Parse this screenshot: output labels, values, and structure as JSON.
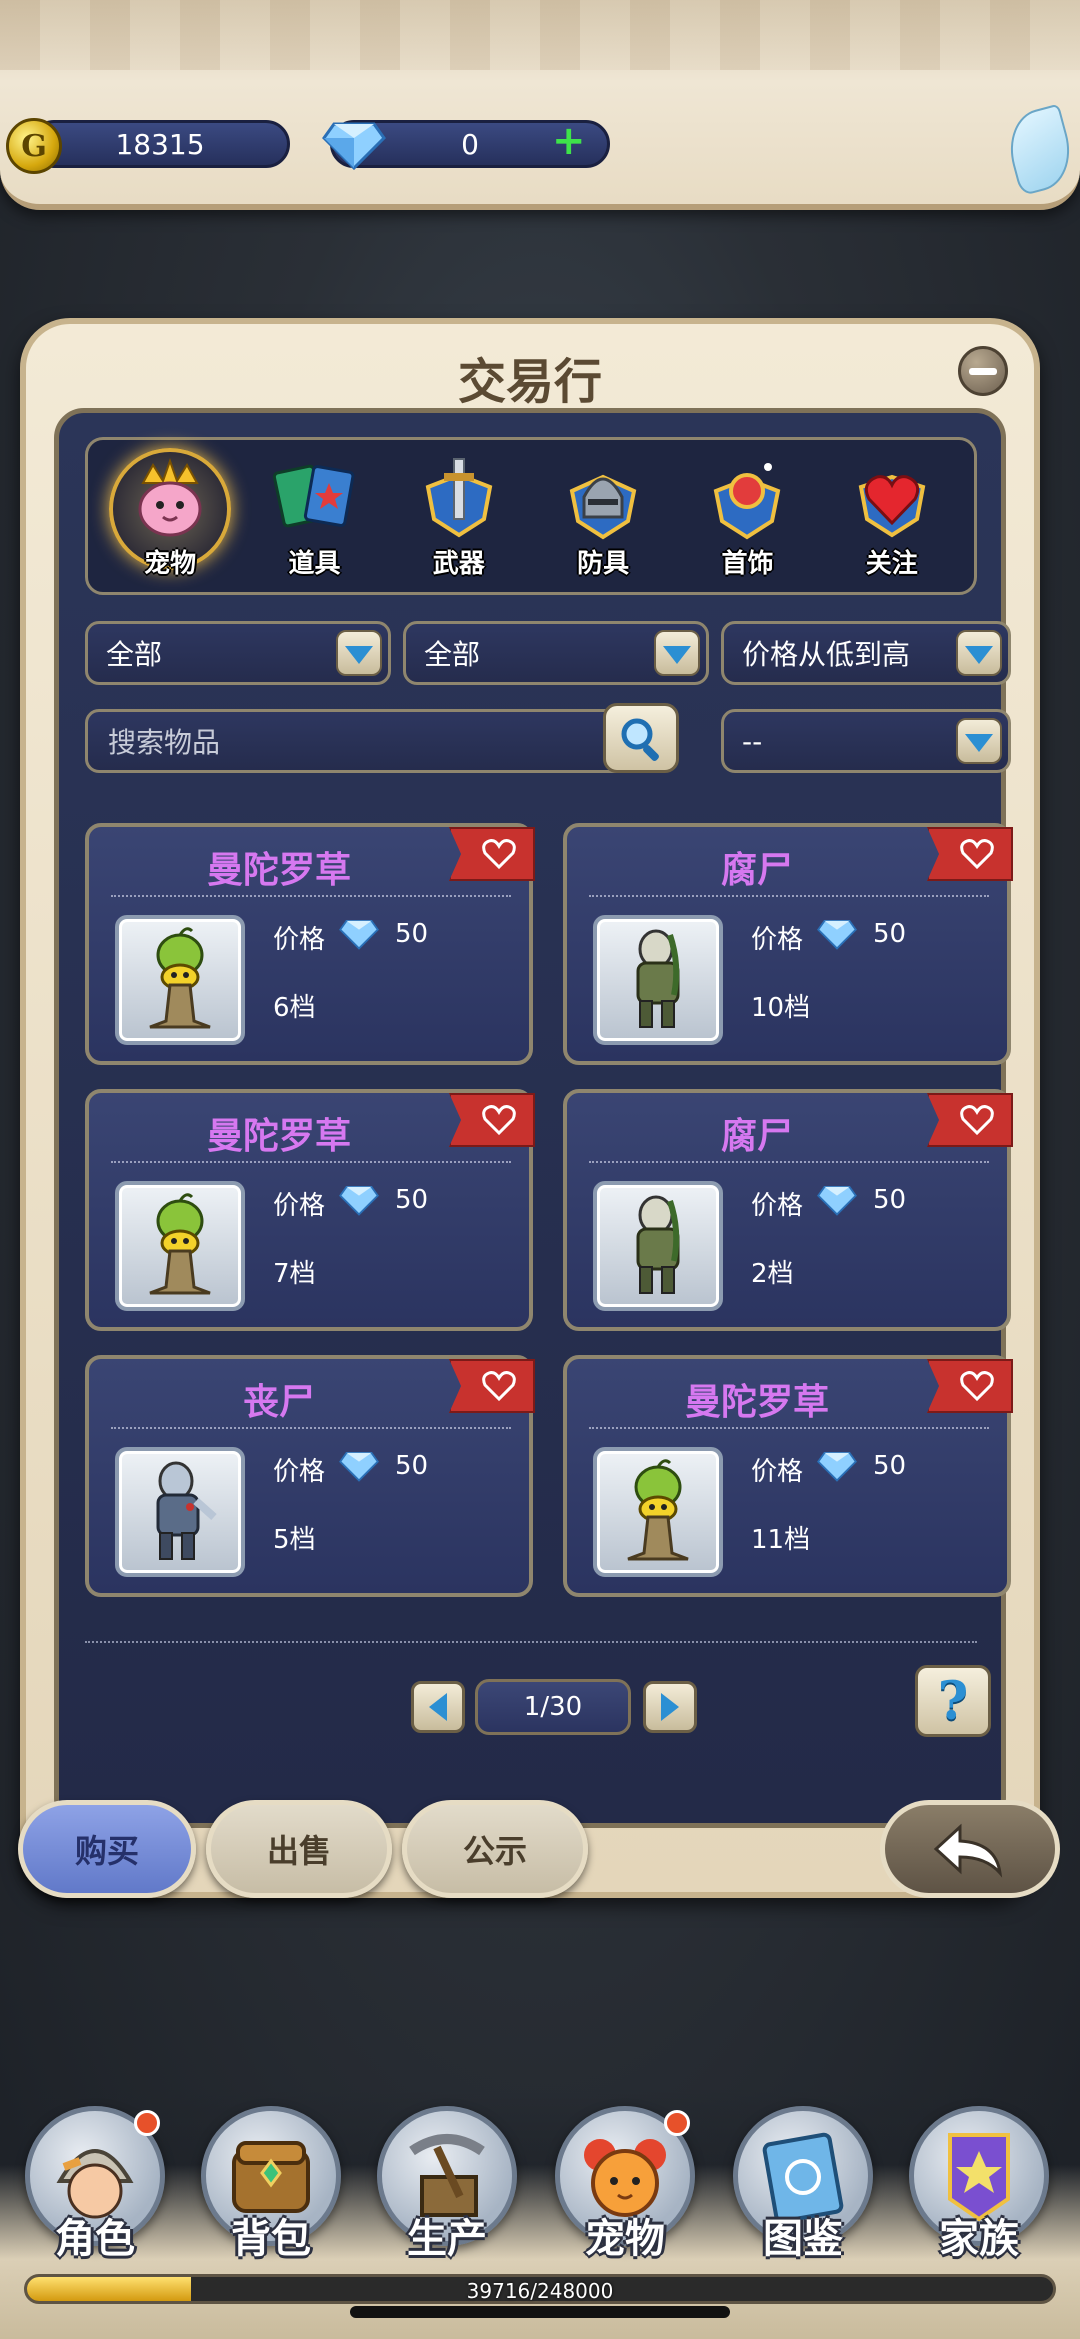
{
  "header": {
    "gold": "18315",
    "gems": "0"
  },
  "panel": {
    "title": "交易行",
    "categories": [
      {
        "label": "宠物",
        "icon": "pet-icon",
        "active": true
      },
      {
        "label": "道具",
        "icon": "items-icon",
        "active": false
      },
      {
        "label": "武器",
        "icon": "weapon-icon",
        "active": false
      },
      {
        "label": "防具",
        "icon": "armor-icon",
        "active": false
      },
      {
        "label": "首饰",
        "icon": "jewelry-icon",
        "active": false
      },
      {
        "label": "关注",
        "icon": "heart-icon",
        "active": false
      }
    ],
    "filters": {
      "filter1": "全部",
      "filter2": "全部",
      "sort": "价格从低到高",
      "search_placeholder": "搜索物品",
      "filter4": "--"
    },
    "listings": [
      {
        "name": "曼陀罗草",
        "price_label": "价格",
        "price": "50",
        "tier": "6档",
        "portrait": "mandrake-icon"
      },
      {
        "name": "腐尸",
        "price_label": "价格",
        "price": "50",
        "tier": "10档",
        "portrait": "rotting-corpse-icon"
      },
      {
        "name": "曼陀罗草",
        "price_label": "价格",
        "price": "50",
        "tier": "7档",
        "portrait": "mandrake-icon"
      },
      {
        "name": "腐尸",
        "price_label": "价格",
        "price": "50",
        "tier": "2档",
        "portrait": "rotting-corpse-icon"
      },
      {
        "name": "丧尸",
        "price_label": "价格",
        "price": "50",
        "tier": "5档",
        "portrait": "zombie-icon"
      },
      {
        "name": "曼陀罗草",
        "price_label": "价格",
        "price": "50",
        "tier": "11档",
        "portrait": "mandrake-icon"
      }
    ],
    "pagination": "1/30",
    "help": "?"
  },
  "tabs": {
    "buy": "购买",
    "sell": "出售",
    "notice": "公示"
  },
  "bottom_nav": [
    {
      "label": "角色",
      "icon": "character-icon",
      "badge": true
    },
    {
      "label": "背包",
      "icon": "backpack-icon",
      "badge": false
    },
    {
      "label": "生产",
      "icon": "production-icon",
      "badge": false
    },
    {
      "label": "宠物",
      "icon": "pet-icon",
      "badge": true
    },
    {
      "label": "图鉴",
      "icon": "codex-icon",
      "badge": false
    },
    {
      "label": "家族",
      "icon": "family-icon",
      "badge": false
    }
  ],
  "xp": {
    "text": "39716/248000",
    "fraction": 0.16
  },
  "colors": {
    "item_name": "#d678f0",
    "favorite_ribbon": "#c8322e",
    "panel_bg": "#2b3558",
    "active_tab": "#6179c9"
  }
}
